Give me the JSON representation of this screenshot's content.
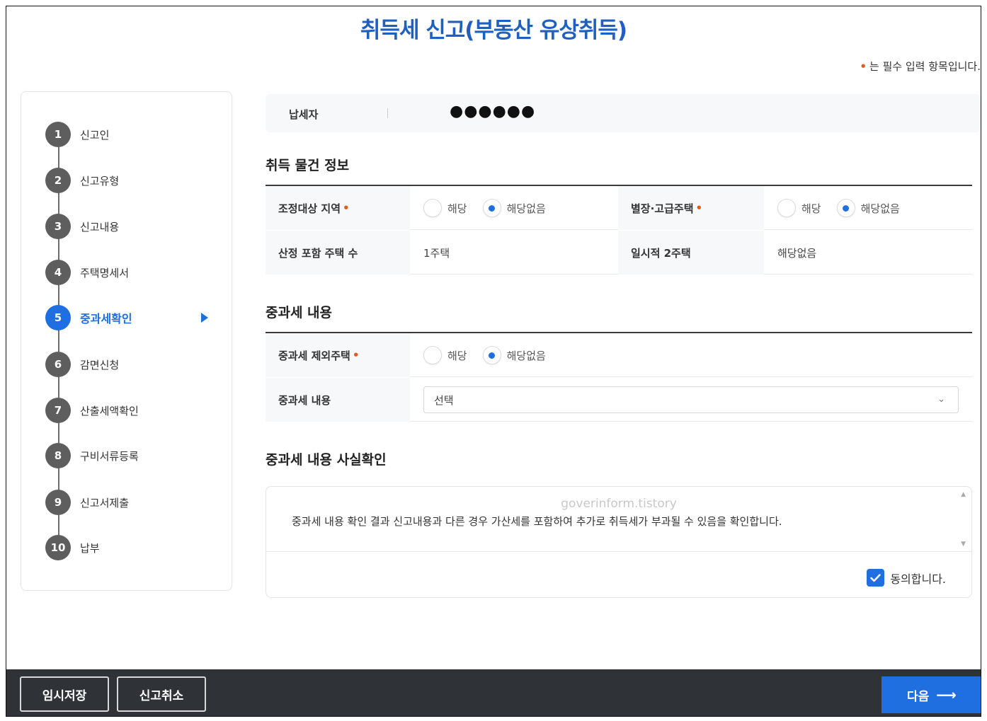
{
  "page": {
    "title": "취득세 신고(부동산 유상취득)",
    "required_mark": "•",
    "required_note": "는 필수 입력 항목입니다."
  },
  "sidebar": {
    "steps": [
      {
        "num": "1",
        "label": "신고인"
      },
      {
        "num": "2",
        "label": "신고유형"
      },
      {
        "num": "3",
        "label": "신고내용"
      },
      {
        "num": "4",
        "label": "주택명세서"
      },
      {
        "num": "5",
        "label": "중과세확인",
        "active": true
      },
      {
        "num": "6",
        "label": "감면신청"
      },
      {
        "num": "7",
        "label": "산출세액확인"
      },
      {
        "num": "8",
        "label": "구비서류등록"
      },
      {
        "num": "9",
        "label": "신고서제출"
      },
      {
        "num": "10",
        "label": "납부"
      }
    ]
  },
  "payer": {
    "label": "납세자",
    "value": "●●●●●●"
  },
  "acquisition_info": {
    "title": "취득 물건 정보",
    "adjusted_area_label": "조정대상 지역",
    "adjusted_area_options": [
      "해당",
      "해당없음"
    ],
    "adjusted_area_selected": "해당없음",
    "villa_label": "별장·고급주택",
    "villa_options": [
      "해당",
      "해당없음"
    ],
    "villa_selected": "해당없음",
    "house_count_label": "산정 포함 주택 수",
    "house_count_value": "1주택",
    "temp_two_label": "일시적 2주택",
    "temp_two_value": "해당없음"
  },
  "heavy_tax": {
    "title": "중과세 내용",
    "excluded_label": "중과세 제외주택",
    "excluded_options": [
      "해당",
      "해당없음"
    ],
    "excluded_selected": "해당없음",
    "content_label": "중과세 내용",
    "content_select_value": "선택"
  },
  "fact_check": {
    "title": "중과세 내용 사실확인",
    "watermark": "goverinform.tistory",
    "text": "중과세 내용 확인 결과 신고내용과 다른 경우 가산세를 포함하여 추가로 취득세가 부과될 수 있음을 확인합니다.",
    "agree_label": "동의합니다.",
    "agree_checked": true
  },
  "bottom": {
    "temp_save": "임시저장",
    "cancel": "신고취소",
    "next": "다음",
    "next_arrow": "⟶"
  },
  "colors": {
    "accent": "#1f6fe0",
    "title": "#1f5fbf",
    "required": "#e05a1a",
    "step_default": "#5e5e5e",
    "bottom_bar": "#2f3236"
  }
}
